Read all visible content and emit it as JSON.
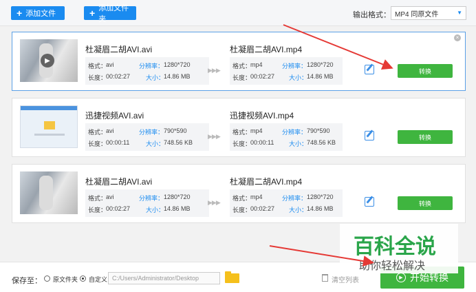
{
  "toolbar": {
    "add_file_label": "添加文件",
    "add_folder_label": "添加文件夹",
    "output_format_label": "输出格式：",
    "output_format_value": "MP4  同原文件"
  },
  "labels": {
    "format": "格式：",
    "resolution": "分辨率：",
    "duration": "长度：",
    "size": "大小："
  },
  "files": [
    {
      "source_name": "杜凝眉二胡AVI.avi",
      "source_format": "avi",
      "source_resolution": "1280*720",
      "source_duration": "00:02:27",
      "source_size": "14.86 MB",
      "target_name": "杜凝眉二胡AVI.mp4",
      "target_format": "mp4",
      "target_resolution": "1280*720",
      "target_duration": "00:02:27",
      "target_size": "14.86 MB",
      "convert_label": "转换"
    },
    {
      "source_name": "迅捷视频AVI.avi",
      "source_format": "avi",
      "source_resolution": "790*590",
      "source_duration": "00:00:11",
      "source_size": "748.56 KB",
      "target_name": "迅捷视频AVI.mp4",
      "target_format": "mp4",
      "target_resolution": "790*590",
      "target_duration": "00:00:11",
      "target_size": "748.56 KB",
      "convert_label": "转换"
    },
    {
      "source_name": "杜凝眉二胡AVI.avi",
      "source_format": "avi",
      "source_resolution": "1280*720",
      "source_duration": "00:02:27",
      "source_size": "14.86 MB",
      "target_name": "杜凝眉二胡AVI.mp4",
      "target_format": "mp4",
      "target_resolution": "1280*720",
      "target_duration": "00:02:27",
      "target_size": "14.86 MB",
      "convert_label": "转换"
    }
  ],
  "bottom": {
    "save_to_label": "保存至：",
    "original_folder_label": "原文件夹",
    "custom_label": "自定义",
    "save_path": "C:/Users/Administrator/Desktop",
    "clear_list_label": "清空列表",
    "start_convert_label": "开始转换"
  },
  "watermark": {
    "main": "百科全说",
    "sub": "助你轻松解决"
  },
  "icons": {
    "add": "plus-icon",
    "play": "play-icon",
    "edit": "edit-icon",
    "close": "close-icon",
    "folder": "folder-icon",
    "trash": "trash-icon",
    "start": "play-circle-icon"
  },
  "colors": {
    "primary_blue": "#1a8bf0",
    "convert_green": "#3fb53f",
    "annotation_red": "#e53935",
    "watermark_green": "#2aa54a"
  }
}
